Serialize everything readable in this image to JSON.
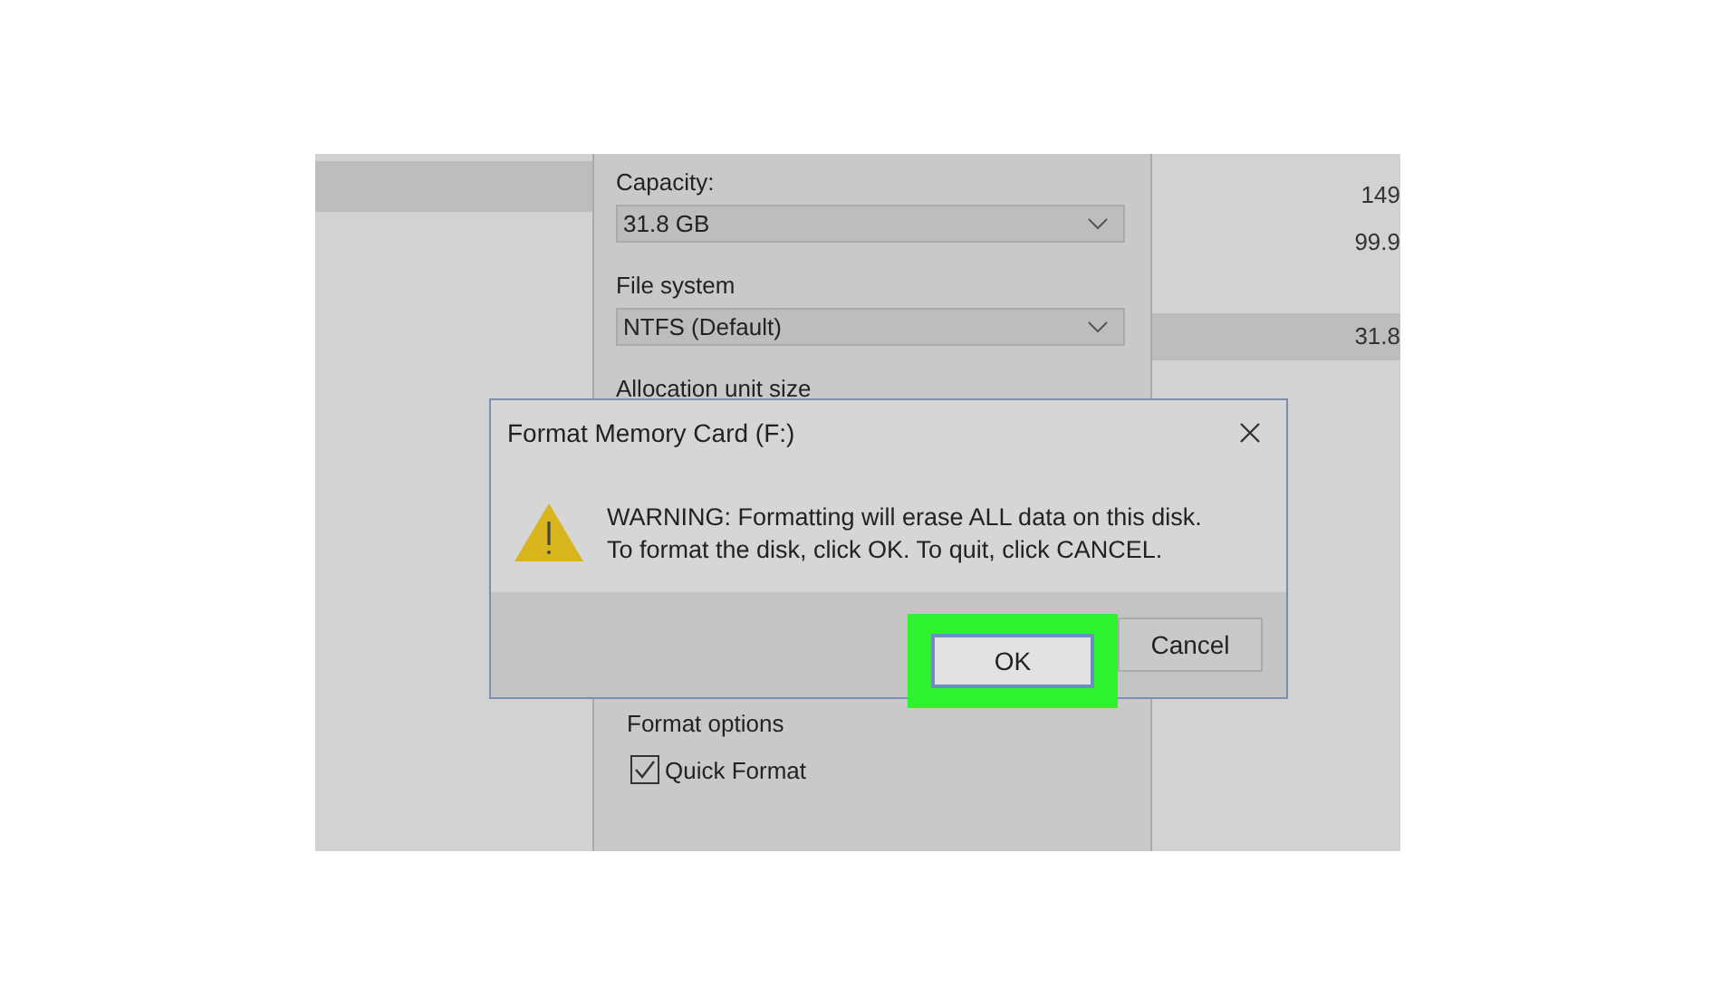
{
  "background_list": {
    "rows": [
      {
        "value": "149",
        "selected": false
      },
      {
        "value": "99.9",
        "selected": false
      },
      {
        "value": "31.8",
        "selected": true
      }
    ]
  },
  "format_window": {
    "capacity_label": "Capacity:",
    "capacity_value": "31.8 GB",
    "file_system_label": "File system",
    "file_system_value": "NTFS (Default)",
    "allocation_label": "Allocation unit size",
    "format_options_label": "Format options",
    "quick_format": {
      "label": "Quick Format",
      "checked": true
    }
  },
  "dialog": {
    "title": "Format Memory Card (F:)",
    "message_lines": [
      "WARNING: Formatting will erase ALL data on this disk.",
      "To format the disk, click OK. To quit, click CANCEL."
    ],
    "buttons": [
      {
        "label": "OK",
        "highlighted": true
      },
      {
        "label": "Cancel",
        "highlighted": false
      }
    ]
  }
}
